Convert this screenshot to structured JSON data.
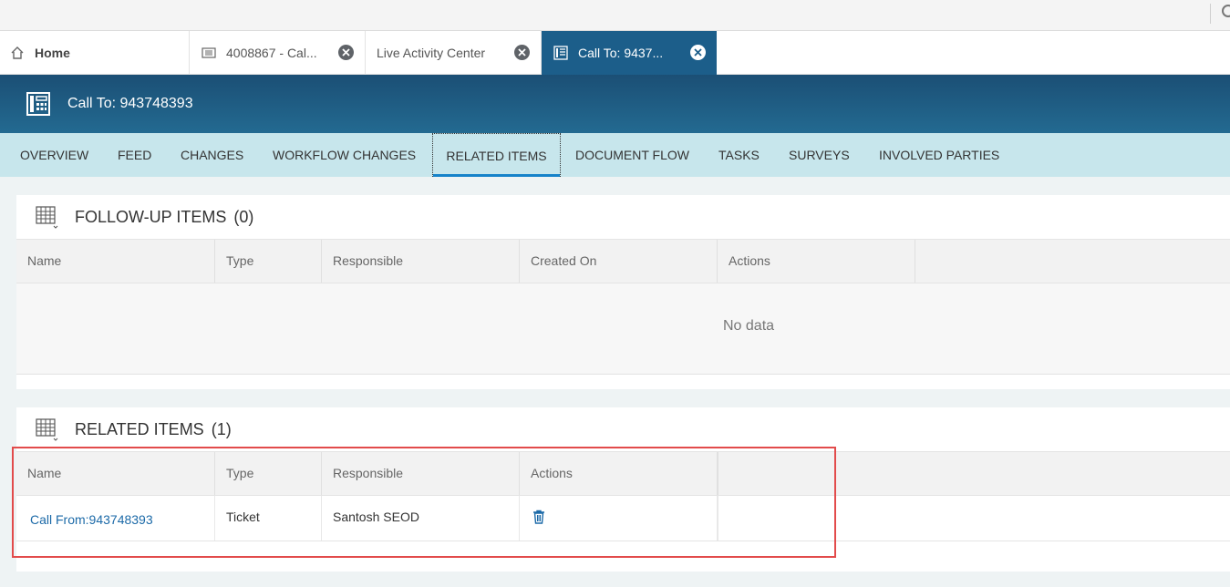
{
  "tabs": [
    {
      "label": "Home",
      "icon": "home-icon"
    },
    {
      "label": "4008867 - Cal...",
      "icon": "ticket-icon"
    },
    {
      "label": "Live Activity Center"
    },
    {
      "label": "Call To: 9437...",
      "icon": "phone-icon"
    }
  ],
  "header": {
    "title": "Call To: 943748393",
    "icon": "phone-icon"
  },
  "subnav": [
    "OVERVIEW",
    "FEED",
    "CHANGES",
    "WORKFLOW CHANGES",
    "RELATED ITEMS",
    "DOCUMENT FLOW",
    "TASKS",
    "SURVEYS",
    "INVOLVED PARTIES"
  ],
  "followup": {
    "title": "FOLLOW-UP ITEMS",
    "count": "(0)",
    "columns": [
      "Name",
      "Type",
      "Responsible",
      "Created On",
      "Actions"
    ],
    "empty_text": "No data"
  },
  "related": {
    "title": "RELATED ITEMS",
    "count": "(1)",
    "columns": [
      "Name",
      "Type",
      "Responsible",
      "Actions"
    ],
    "rows": [
      {
        "name": "Call From:943748393",
        "type": "Ticket",
        "responsible": "Santosh SEOD",
        "action_icon": "trash-icon"
      }
    ]
  },
  "colors": {
    "header": "#1c5e8a",
    "subnav": "#c7e6ec",
    "accent": "#1582c9",
    "highlight": "#e24b4b"
  }
}
